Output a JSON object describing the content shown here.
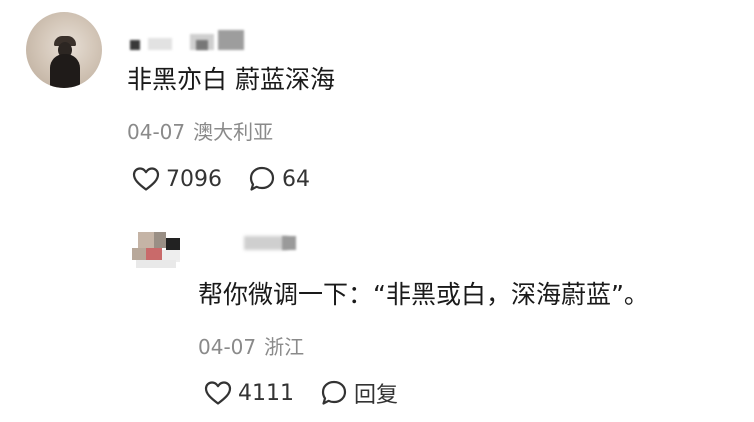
{
  "comment": {
    "text": "非黑亦白 蔚蓝深海",
    "date": "04-07",
    "location": "澳大利亚",
    "like_count": "7096",
    "reply_count": "64",
    "like_icon": "heart-outline-icon",
    "reply_icon": "speech-bubble-icon"
  },
  "reply": {
    "text": "帮你微调一下：“非黑或白，深海蔚蓝”。",
    "date": "04-07",
    "location": "浙江",
    "like_count": "4111",
    "reply_label": "回复",
    "like_icon": "heart-outline-icon",
    "reply_icon": "speech-bubble-icon"
  },
  "colors": {
    "text_primary": "#1a1a1a",
    "text_secondary": "#8a8a8a",
    "icon": "#333333",
    "background": "#ffffff"
  }
}
